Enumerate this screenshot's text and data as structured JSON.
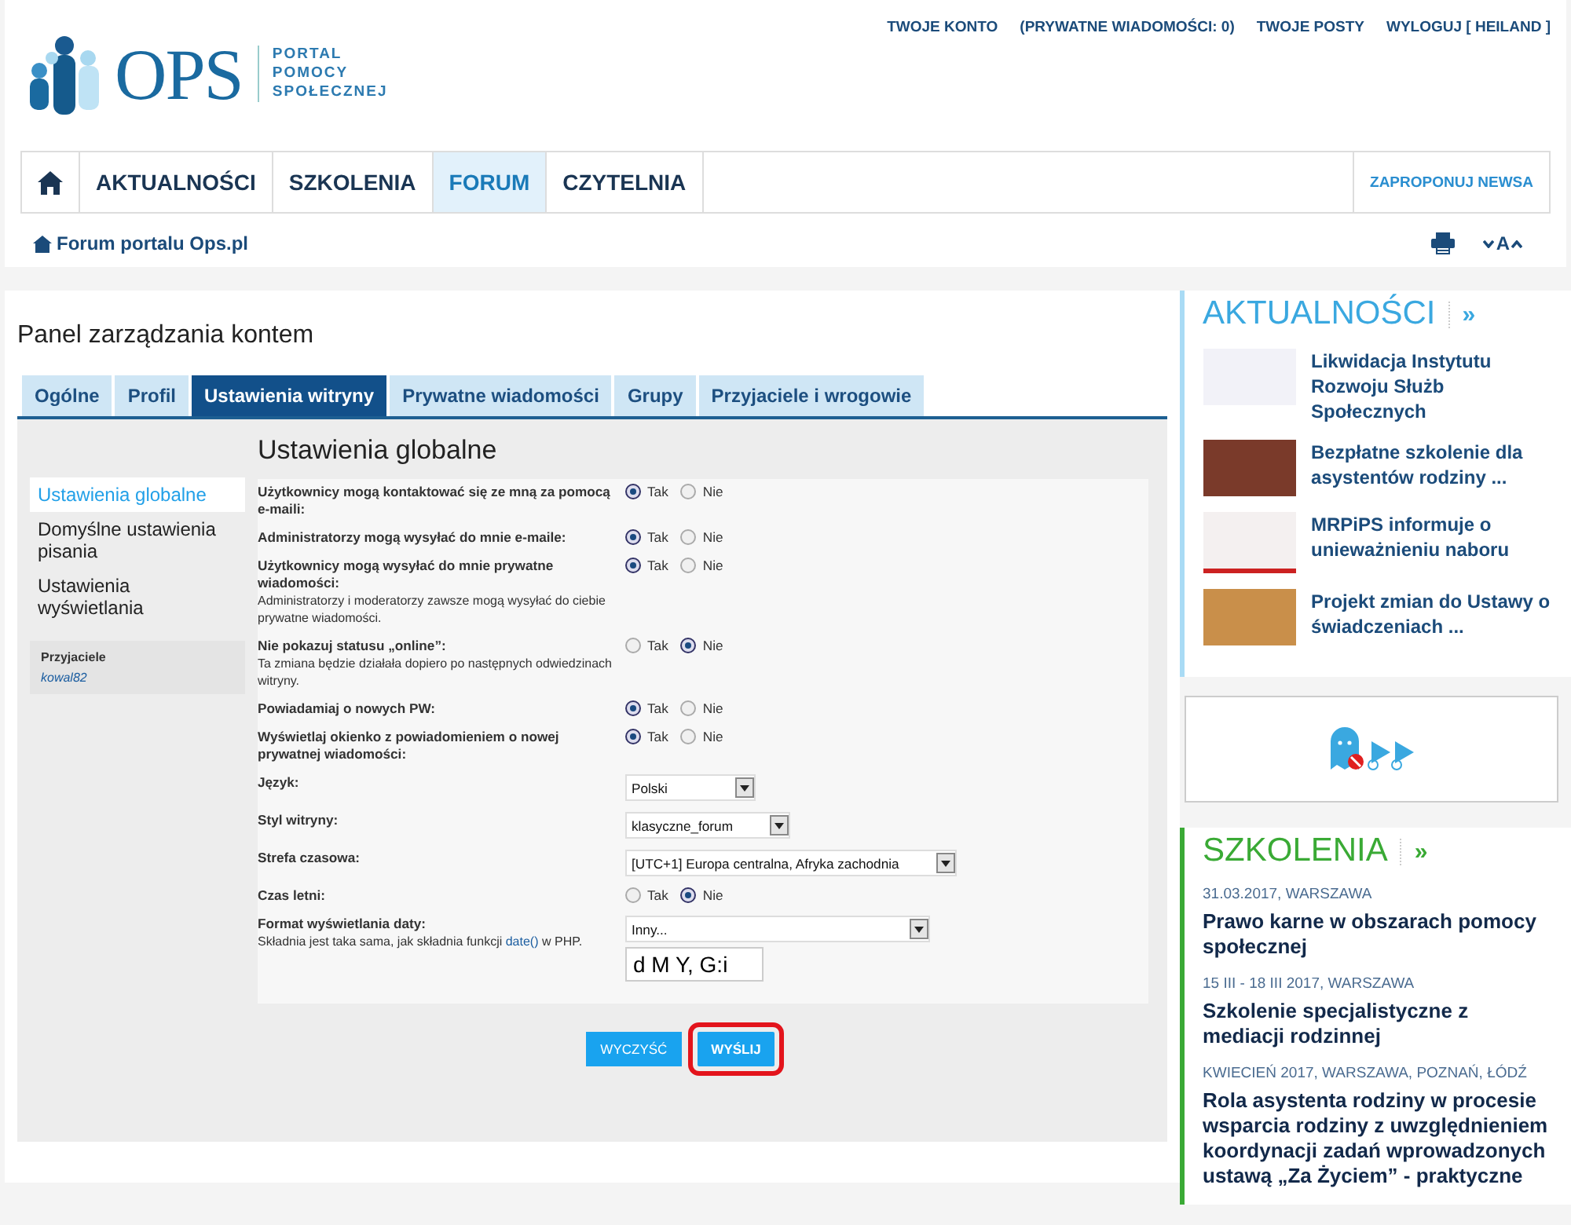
{
  "top_links": [
    {
      "label": "TWOJE KONTO"
    },
    {
      "label": "(PRYWATNE WIADOMOŚCI: **0**)"
    },
    {
      "label": "TWOJE POSTY"
    },
    {
      "label": "WYLOGUJ [ HEILAND ]"
    }
  ],
  "logo": {
    "wordmark": "OPS",
    "tagline": [
      "PORTAL",
      "POMOCY",
      "SPOŁECZNEJ"
    ]
  },
  "nav": {
    "items": [
      {
        "kind": "home",
        "selected": false
      },
      {
        "kind": "text",
        "label": "AKTUALNOŚCI",
        "selected": false
      },
      {
        "kind": "text",
        "label": "SZKOLENIA",
        "selected": false
      },
      {
        "kind": "text",
        "label": "FORUM",
        "selected": true
      },
      {
        "kind": "text",
        "label": "CZYTELNIA",
        "selected": false
      }
    ],
    "action": "ZAPROPONUJ NEWSA"
  },
  "breadcrumb": {
    "label": "Forum portalu Ops.pl",
    "font_size_label": "A"
  },
  "panel": {
    "title": "Panel zarządzania kontem",
    "tabs": [
      {
        "label": "Ogólne",
        "selected": false
      },
      {
        "label": "Profil",
        "selected": false
      },
      {
        "label": "Ustawienia witryny",
        "selected": true
      },
      {
        "label": "Prywatne wiadomości",
        "selected": false
      },
      {
        "label": "Grupy",
        "selected": false
      },
      {
        "label": "Przyjaciele i wrogowie",
        "selected": false
      }
    ],
    "side_menu": [
      {
        "label": "Ustawienia globalne",
        "selected": true
      },
      {
        "label": "Domyślne ustawienia pisania",
        "selected": false
      },
      {
        "label": "Ustawienia wyświetlania",
        "selected": false
      }
    ],
    "friends": {
      "title": "Przyjaciele",
      "items": [
        "kowal82"
      ]
    },
    "section_title": "Ustawienia globalne",
    "settings": [
      {
        "kind": "radio",
        "label": "Użytkownicy mogą kontaktować się ze mną za pomocą e-maili:",
        "options": [
          {
            "label": "Tak",
            "selected": true
          },
          {
            "label": "Nie",
            "selected": false
          }
        ]
      },
      {
        "kind": "radio",
        "label": "Administratorzy mogą wysyłać do mnie e-maile:",
        "options": [
          {
            "label": "Tak",
            "selected": true
          },
          {
            "label": "Nie",
            "selected": false
          }
        ]
      },
      {
        "kind": "radio",
        "label": "Użytkownicy mogą wysyłać do mnie prywatne wiadomości:",
        "hint": "Administratorzy i moderatorzy zawsze mogą wysyłać do ciebie prywatne wiadomości.",
        "options": [
          {
            "label": "Tak",
            "selected": true
          },
          {
            "label": "Nie",
            "selected": false
          }
        ]
      },
      {
        "kind": "radio",
        "label": "Nie pokazuj statusu „online”:",
        "hint": "Ta zmiana będzie działała dopiero po następnych odwiedzinach witryny.",
        "options": [
          {
            "label": "Tak",
            "selected": false
          },
          {
            "label": "Nie",
            "selected": true
          }
        ]
      },
      {
        "kind": "radio",
        "label": "Powiadamiaj o nowych PW:",
        "options": [
          {
            "label": "Tak",
            "selected": true
          },
          {
            "label": "Nie",
            "selected": false
          }
        ]
      },
      {
        "kind": "radio",
        "label": "Wyświetlaj okienko z powiadomieniem o nowej prywatnej wiadomości:",
        "options": [
          {
            "label": "Tak",
            "selected": true
          },
          {
            "label": "Nie",
            "selected": false
          }
        ]
      },
      {
        "kind": "select",
        "label": "Język:",
        "value": "Polski"
      },
      {
        "kind": "select",
        "label": "Styl witryny:",
        "value": "klasyczne_forum"
      },
      {
        "kind": "select",
        "label": "Strefa czasowa:",
        "value": "[UTC+1] Europa centralna, Afryka zachodnia"
      },
      {
        "kind": "radio",
        "label": "Czas letni:",
        "options": [
          {
            "label": "Tak",
            "selected": false
          },
          {
            "label": "Nie",
            "selected": true
          }
        ]
      },
      {
        "kind": "date_format",
        "label": "Format wyświetlania daty:",
        "hint": "Składnia jest taka sama, jak składnia funkcji ",
        "hint_link": "date()",
        "hint_end": " w PHP.",
        "value": "Inny...",
        "input": "d M Y, G:i"
      }
    ],
    "buttons": [
      {
        "label": "WYCZYŚĆ",
        "highlighted": false
      },
      {
        "label": "WYŚLIJ",
        "highlighted": true
      }
    ]
  },
  "news": {
    "title": "AKTUALNOŚCI",
    "more": "»",
    "items": [
      {
        "title": "Likwidacja Instytutu Rozwoju Służb Społecznych"
      },
      {
        "title": "Bezpłatne szkolenie dla asystentów rodziny ..."
      },
      {
        "title": "MRPiPS informuje o unieważnieniu naboru"
      },
      {
        "title": "Projekt zmian do Ustawy o świadczeniach ..."
      }
    ]
  },
  "trainings": {
    "title": "SZKOLENIA",
    "more": "»",
    "items": [
      {
        "meta": "31.03.2017, WARSZAWA",
        "title": "Prawo karne w obszarach pomocy społecznej"
      },
      {
        "meta": "15 III - 18 III 2017, WARSZAWA",
        "title": "Szkolenie specjalistyczne z mediacji rodzinnej"
      },
      {
        "meta": "KWIECIEŃ 2017, WARSZAWA, POZNAŃ, ŁÓDŹ",
        "title": "Rola asystenta rodziny w procesie wsparcia rodziny z uwzględnieniem koordynacji zadań wprowadzonych ustawą „Za Życiem” - praktyczne"
      }
    ]
  }
}
